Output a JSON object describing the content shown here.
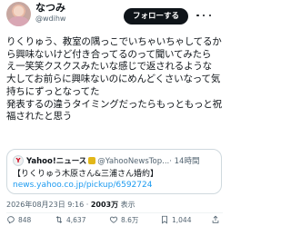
{
  "author": {
    "name": "なつみ",
    "handle": "@wdihw"
  },
  "follow_label": "フォローする",
  "post": {
    "text": "りくりゅう、教室の隅っこでいちゃいちゃしてるか\nら興味ないけど付き合ってるのって聞いてみたら\nえ一笑笑クスクスみたいな感じで返されるような\n大してお前らに興味ないのにめんどくさいなって気\n持ちにずっとなってた\n発表するの違うタイミングだったらもっともっと祝\n福されたと思う"
  },
  "quote": {
    "name": "Yahoo!ニュース",
    "handle": "@YahooNewsTop...",
    "time": "· 14時間",
    "headline": "【りくりゅう木原さん&三浦さん婚約】",
    "link": "news.yahoo.co.jp/pickup/6592724"
  },
  "meta": {
    "datetime": "2026年08月23日 9:16 · ",
    "views": "2003万",
    "views_label": " 表示"
  },
  "actions": {
    "replies": "848",
    "reposts": "4,637",
    "likes": "8.6万",
    "bookmarks": "1,044"
  },
  "icons": {
    "more": "more-icon",
    "reply": "reply-icon",
    "repost": "repost-icon",
    "like": "like-icon",
    "bookmark": "bookmark-icon",
    "share": "share-icon"
  }
}
